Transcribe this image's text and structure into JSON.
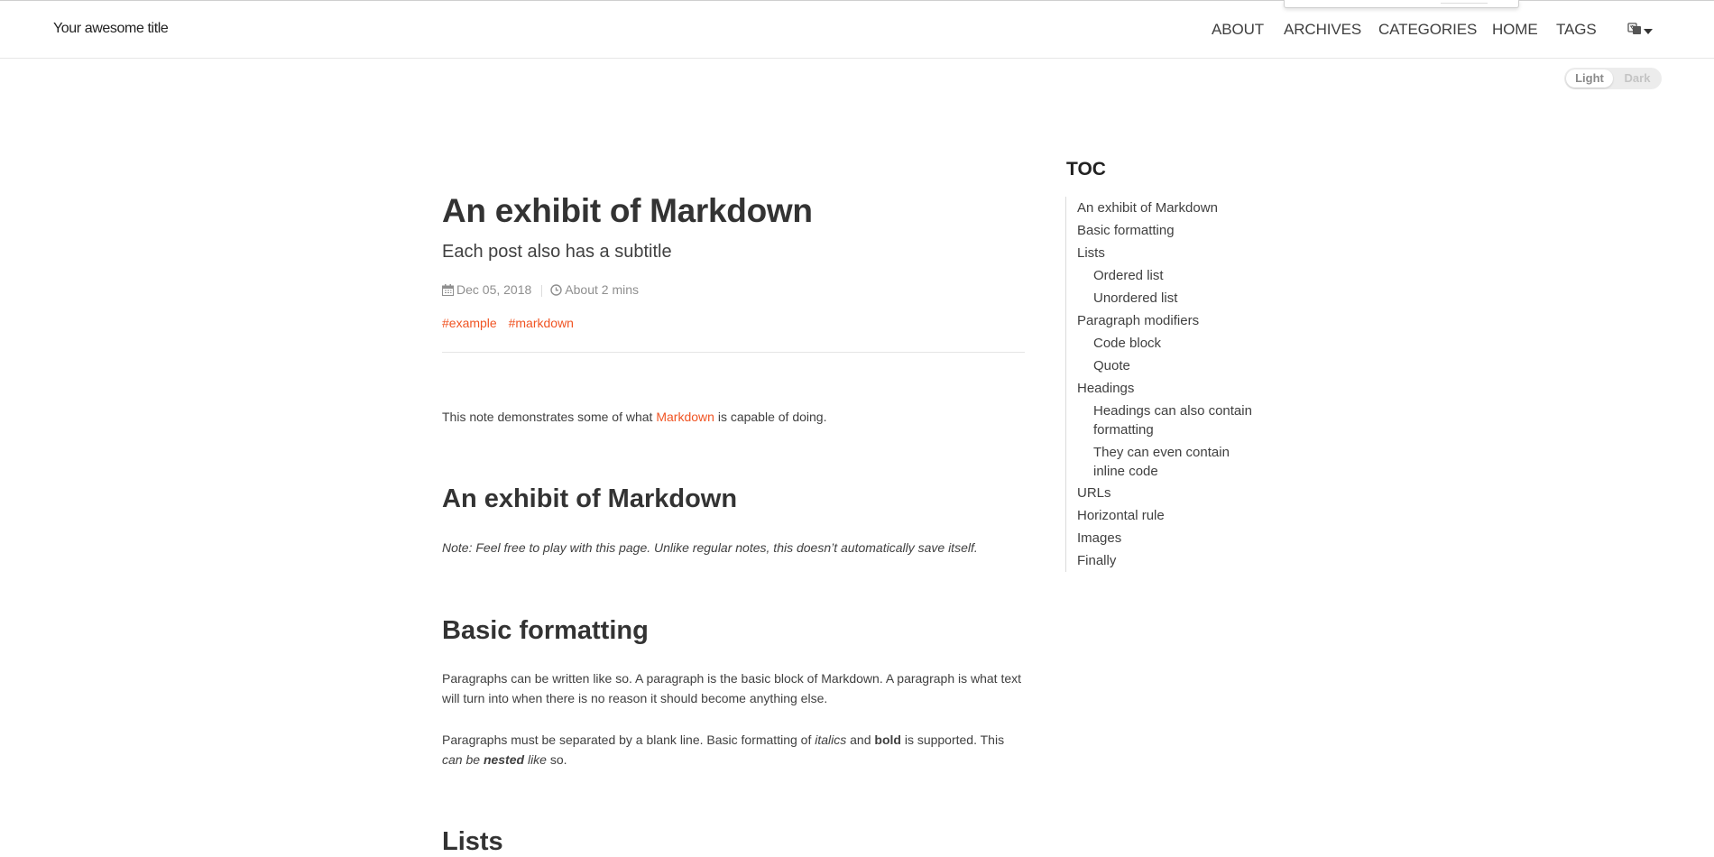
{
  "site": {
    "brand": "Your awesome title"
  },
  "nav": {
    "links": [
      "ABOUT",
      "ARCHIVES",
      "CATEGORIES",
      "HOME",
      "TAGS"
    ],
    "language_icon": "language-icon"
  },
  "theme": {
    "light": "Light",
    "dark": "Dark",
    "selected": "Light"
  },
  "post": {
    "title": "An exhibit of Markdown",
    "subtitle": "Each post also has a subtitle",
    "date": "Dec 05, 2018",
    "read_time": "About 2 mins",
    "tags": [
      "#example",
      "#markdown"
    ],
    "intro_before": "This note demonstrates some of what ",
    "intro_link": "Markdown",
    "intro_after": " is capable of doing.",
    "h_exhibit": "An exhibit of Markdown",
    "note": "Note: Feel free to play with this page. Unlike regular notes, this doesn’t automatically save itself.",
    "h_basic": "Basic formatting",
    "para1_line1": "Paragraphs can be written like so. A paragraph is the basic block of Markdown. A paragraph is what text",
    "para1_line2": "will turn into when there is no reason it should become anything else.",
    "para2_a": "Paragraphs must be separated by a blank line. Basic formatting of ",
    "para2_italics": "italics",
    "para2_and": " and ",
    "para2_bold": "bold",
    "para2_b": " is supported. This",
    "para2_can_be": "can be ",
    "para2_nested": "nested",
    "para2_like": " like",
    "para2_so": " so.",
    "h_lists": "Lists"
  },
  "toc": {
    "title": "TOC",
    "items": [
      {
        "label": "An exhibit of Markdown",
        "level": 1
      },
      {
        "label": "Basic formatting",
        "level": 1
      },
      {
        "label": "Lists",
        "level": 1
      },
      {
        "label": "Ordered list",
        "level": 2
      },
      {
        "label": "Unordered list",
        "level": 2
      },
      {
        "label": "Paragraph modifiers",
        "level": 1
      },
      {
        "label": "Code block",
        "level": 2
      },
      {
        "label": "Quote",
        "level": 2
      },
      {
        "label": "Headings",
        "level": 1
      },
      {
        "label": "Headings can also contain",
        "label2": "formatting",
        "level": 2
      },
      {
        "label": "They can even contain",
        "label2": "inline code",
        "level": 2
      },
      {
        "label": "URLs",
        "level": 1
      },
      {
        "label": "Horizontal rule",
        "level": 1
      },
      {
        "label": "Images",
        "level": 1
      },
      {
        "label": "Finally",
        "level": 1
      }
    ]
  },
  "colors": {
    "accent": "#f05423",
    "text": "#404040",
    "heading": "#333333"
  }
}
